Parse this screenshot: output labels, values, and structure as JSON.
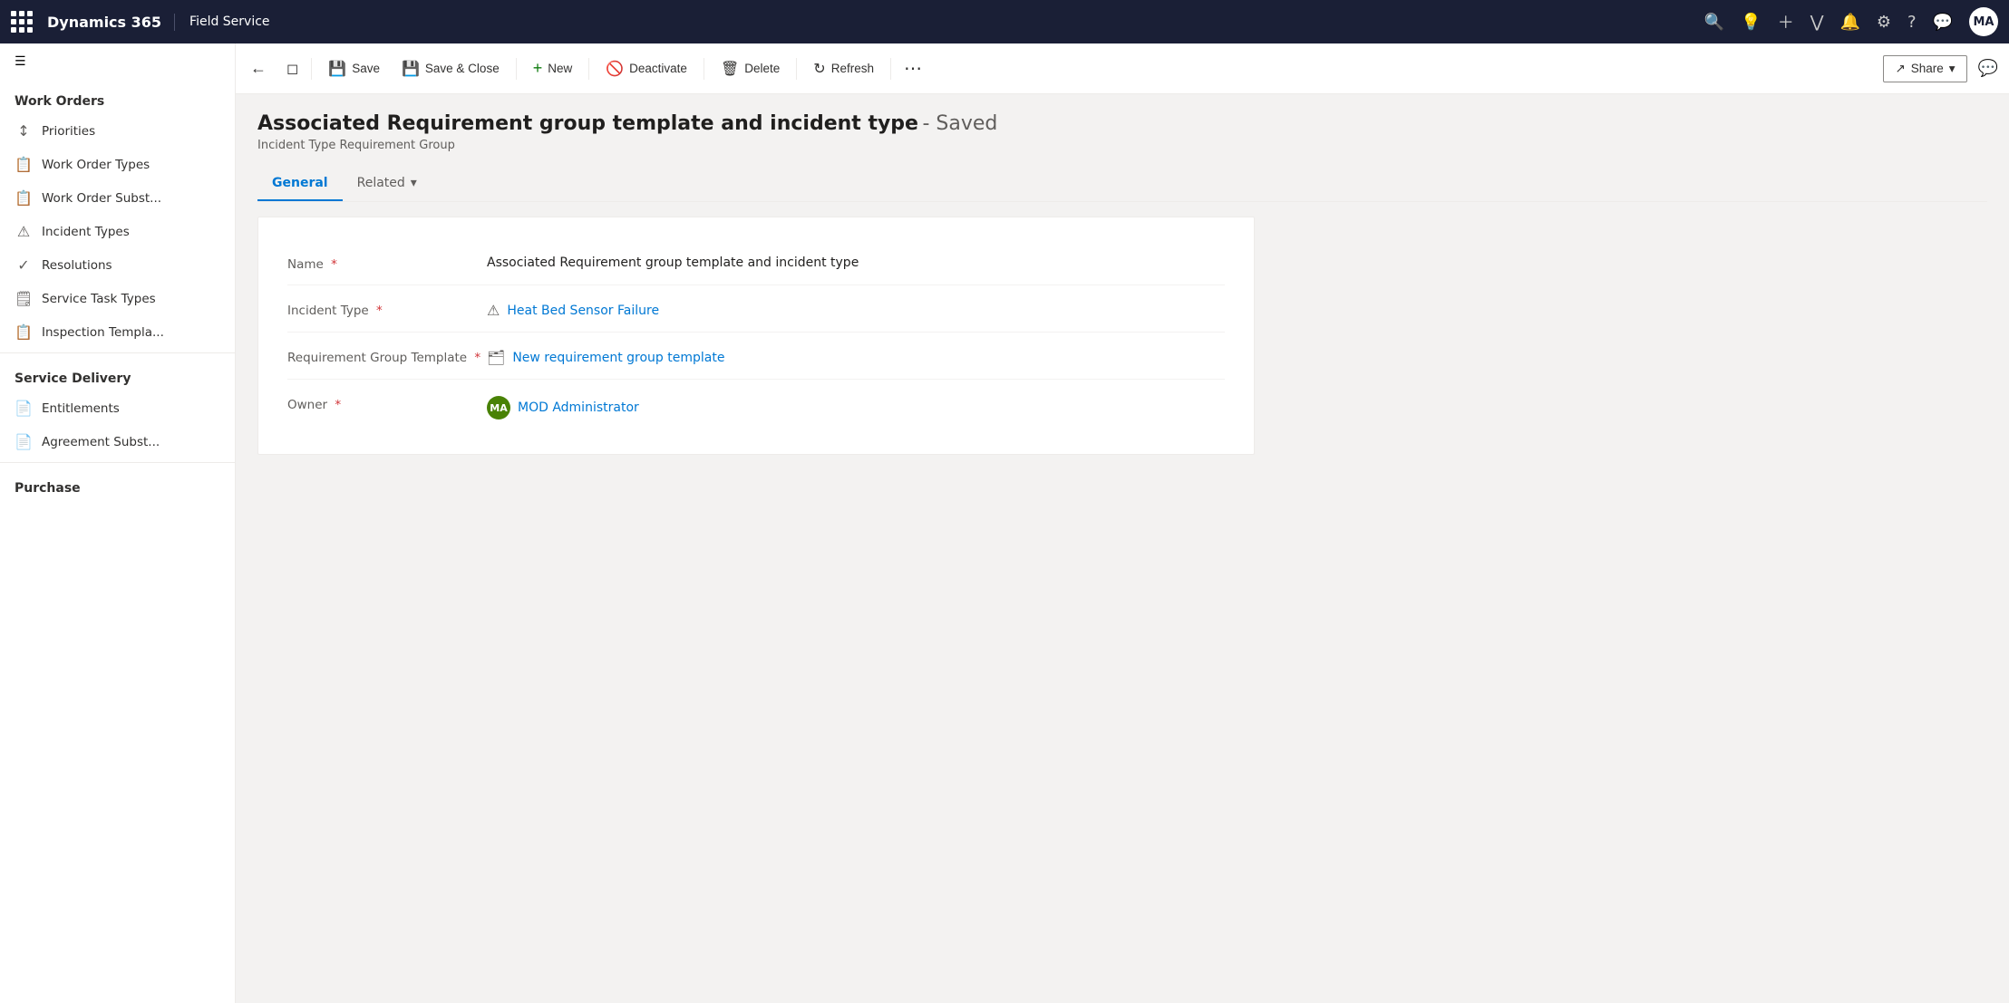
{
  "app": {
    "name": "Dynamics 365",
    "module": "Field Service"
  },
  "topnav": {
    "avatar_initials": "MA",
    "icons": [
      "search",
      "lightbulb",
      "plus",
      "filter",
      "bell",
      "settings",
      "help",
      "chat"
    ]
  },
  "sidebar": {
    "sections": [
      {
        "label": "Work Orders",
        "items": [
          {
            "id": "priorities",
            "label": "Priorities",
            "icon": "↕"
          },
          {
            "id": "work-order-types",
            "label": "Work Order Types",
            "icon": "📋"
          },
          {
            "id": "work-order-subst",
            "label": "Work Order Subst...",
            "icon": "📋"
          },
          {
            "id": "incident-types",
            "label": "Incident Types",
            "icon": "⚠"
          },
          {
            "id": "resolutions",
            "label": "Resolutions",
            "icon": "✓"
          },
          {
            "id": "service-task-types",
            "label": "Service Task Types",
            "icon": "🗒"
          },
          {
            "id": "inspection-templ",
            "label": "Inspection Templa...",
            "icon": "📋"
          }
        ]
      },
      {
        "label": "Service Delivery",
        "items": [
          {
            "id": "entitlements",
            "label": "Entitlements",
            "icon": "📄"
          },
          {
            "id": "agreement-subst",
            "label": "Agreement Subst...",
            "icon": "📄"
          }
        ]
      },
      {
        "label": "Purchase",
        "items": []
      }
    ]
  },
  "commandbar": {
    "back_tooltip": "Back",
    "expand_tooltip": "Expand",
    "save_label": "Save",
    "save_close_label": "Save & Close",
    "new_label": "New",
    "deactivate_label": "Deactivate",
    "delete_label": "Delete",
    "refresh_label": "Refresh",
    "more_label": "...",
    "share_label": "Share",
    "chat_tooltip": "Chat"
  },
  "page": {
    "title": "Associated Requirement group template and incident type",
    "saved_indicator": "- Saved",
    "subtitle": "Incident Type Requirement Group",
    "tabs": [
      {
        "id": "general",
        "label": "General",
        "active": true
      },
      {
        "id": "related",
        "label": "Related",
        "active": false,
        "has_dropdown": true
      }
    ],
    "form": {
      "fields": [
        {
          "id": "name",
          "label": "Name",
          "required": true,
          "value": "Associated Requirement group template and incident type",
          "type": "text"
        },
        {
          "id": "incident-type",
          "label": "Incident Type",
          "required": true,
          "value": "Heat Bed Sensor Failure",
          "type": "link",
          "icon": "warning"
        },
        {
          "id": "requirement-group-template",
          "label": "Requirement Group Template",
          "required": true,
          "value": "New requirement group template",
          "type": "link",
          "icon": "template"
        },
        {
          "id": "owner",
          "label": "Owner",
          "required": true,
          "value": "MOD Administrator",
          "type": "owner",
          "avatar_initials": "MA"
        }
      ]
    }
  }
}
